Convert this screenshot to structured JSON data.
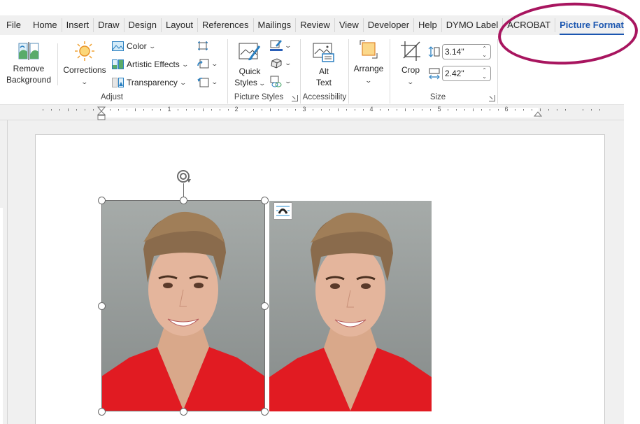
{
  "tabs": [
    {
      "label": "File"
    },
    {
      "label": "Home"
    },
    {
      "label": "Insert"
    },
    {
      "label": "Draw"
    },
    {
      "label": "Design"
    },
    {
      "label": "Layout"
    },
    {
      "label": "References"
    },
    {
      "label": "Mailings"
    },
    {
      "label": "Review"
    },
    {
      "label": "View"
    },
    {
      "label": "Developer"
    },
    {
      "label": "Help"
    },
    {
      "label": "DYMO Label"
    },
    {
      "label": "ACROBAT"
    },
    {
      "label": "Picture Format",
      "active": true
    }
  ],
  "ribbon": {
    "adjust": {
      "group_label": "Adjust",
      "remove_background_line1": "Remove",
      "remove_background_line2": "Background",
      "corrections": "Corrections",
      "color": "Color",
      "artistic_effects": "Artistic Effects",
      "transparency": "Transparency"
    },
    "picture_styles": {
      "group_label": "Picture Styles",
      "quick_line1": "Quick",
      "quick_line2": "Styles"
    },
    "accessibility": {
      "group_label": "Accessibility",
      "alt_line1": "Alt",
      "alt_line2": "Text"
    },
    "arrange": {
      "label": "Arrange"
    },
    "size": {
      "group_label": "Size",
      "crop": "Crop",
      "height_value": "3.14\"",
      "width_value": "2.42\""
    }
  },
  "ruler": {
    "numbers": [
      "1",
      "2",
      "3",
      "4",
      "5",
      "6"
    ]
  },
  "document": {
    "images": [
      {
        "name": "photo-1",
        "selected": true
      },
      {
        "name": "photo-2",
        "selected": false
      }
    ]
  },
  "colors": {
    "accent": "#1b56b0",
    "annotation": "#a8155f",
    "shirt": "#e11b22",
    "background_wall": "#8e9392"
  }
}
